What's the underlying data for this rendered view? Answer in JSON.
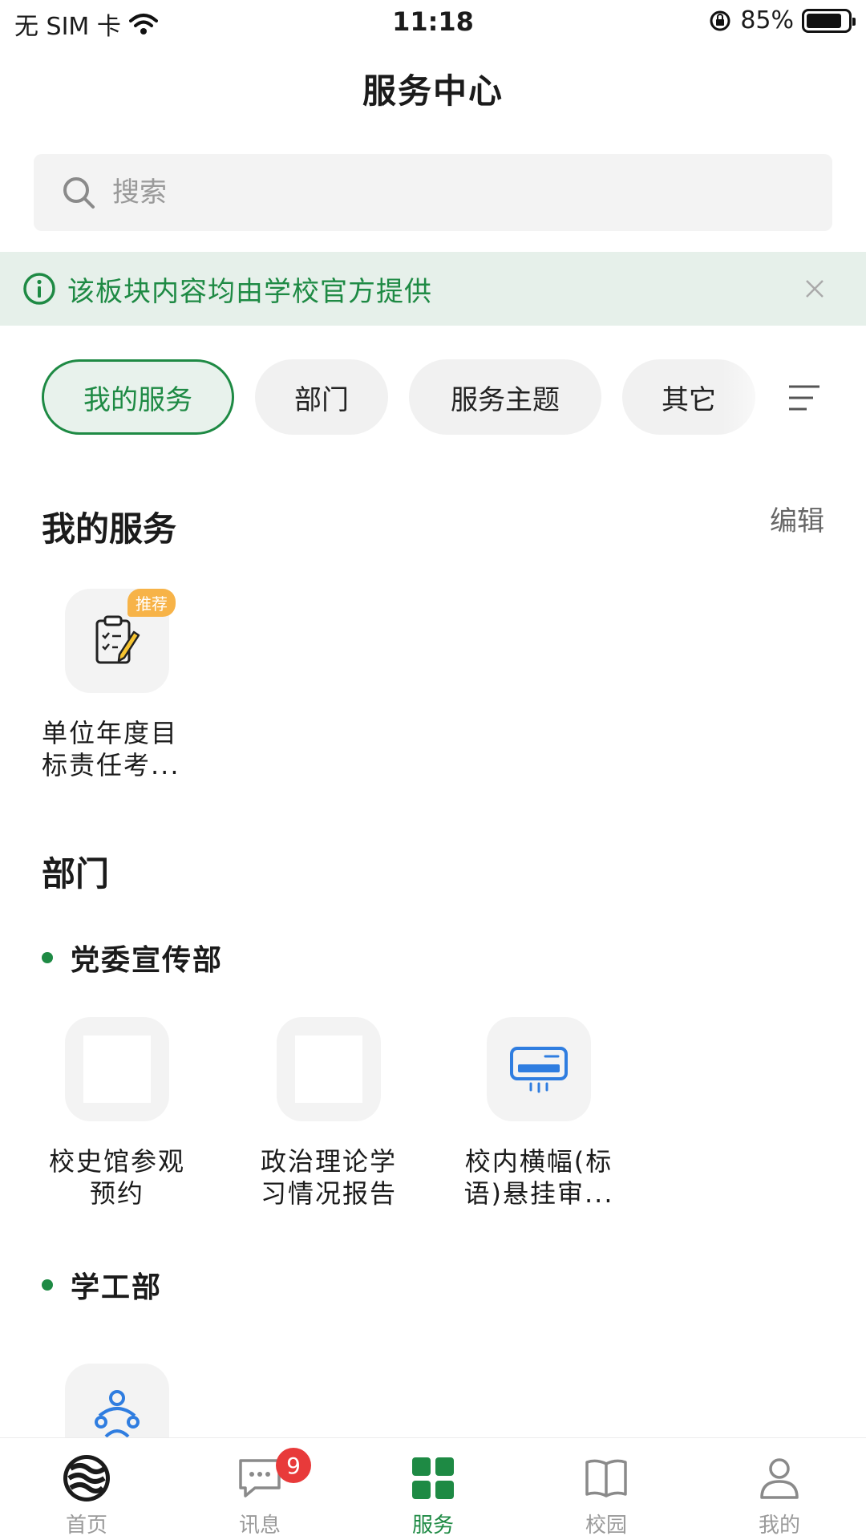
{
  "status_bar": {
    "carrier": "无 SIM 卡",
    "time": "11:18",
    "battery": "85%",
    "battery_level": 0.85
  },
  "header": {
    "title": "服务中心"
  },
  "search": {
    "placeholder": "搜索"
  },
  "notice": {
    "text": "该板块内容均由学校官方提供"
  },
  "tabs": [
    {
      "label": "我的服务",
      "active": true
    },
    {
      "label": "部门",
      "active": false
    },
    {
      "label": "服务主题",
      "active": false
    },
    {
      "label": "其它",
      "active": false
    }
  ],
  "my_services": {
    "title": "我的服务",
    "edit_label": "编辑",
    "items": [
      {
        "label_line1": "单位年度目",
        "label_line2": "标责任考...",
        "badge": "推荐",
        "icon": "clipboard-pencil-icon"
      }
    ]
  },
  "departments": {
    "title": "部门",
    "groups": [
      {
        "name": "党委宣传部",
        "items": [
          {
            "label_line1": "校史馆参观",
            "label_line2": "预约",
            "icon": "blank-icon"
          },
          {
            "label_line1": "政治理论学",
            "label_line2": "习情况报告",
            "icon": "blank-icon"
          },
          {
            "label_line1": "校内横幅(标",
            "label_line2": "语)悬挂审...",
            "icon": "air-conditioner-icon"
          }
        ]
      },
      {
        "name": "学工部",
        "items": [
          {
            "icon": "people-circle-icon"
          }
        ]
      }
    ]
  },
  "tab_bar": {
    "items": [
      {
        "label": "首页",
        "icon": "home-logo-icon",
        "active": false
      },
      {
        "label": "讯息",
        "icon": "message-icon",
        "active": false,
        "badge": "9"
      },
      {
        "label": "服务",
        "icon": "grid-icon",
        "active": true
      },
      {
        "label": "校园",
        "icon": "book-icon",
        "active": false
      },
      {
        "label": "我的",
        "icon": "person-icon",
        "active": false
      }
    ]
  },
  "colors": {
    "accent": "#1e8a44",
    "badge_orange": "#f7b348",
    "badge_red": "#e83a3a",
    "icon_blue": "#2f7de0"
  }
}
